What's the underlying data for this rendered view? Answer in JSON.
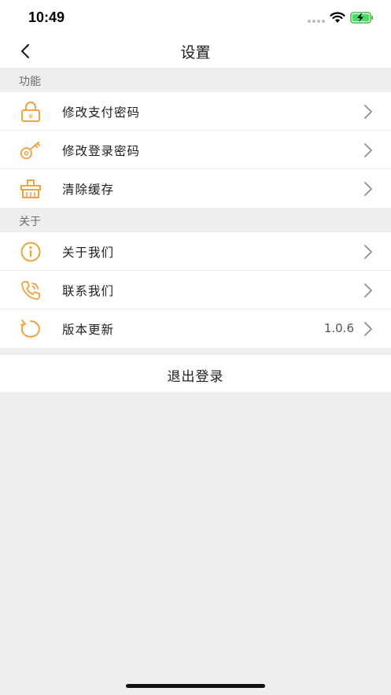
{
  "status_bar": {
    "time": "10:49"
  },
  "header": {
    "title": "设置"
  },
  "sections": [
    {
      "title": "功能",
      "items": [
        {
          "label": "修改支付密码",
          "icon": "payment-lock-icon"
        },
        {
          "label": "修改登录密码",
          "icon": "key-icon"
        },
        {
          "label": "清除缓存",
          "icon": "basket-icon"
        }
      ]
    },
    {
      "title": "关于",
      "items": [
        {
          "label": "关于我们",
          "icon": "info-icon"
        },
        {
          "label": "联系我们",
          "icon": "phone-icon"
        },
        {
          "label": "版本更新",
          "icon": "refresh-icon",
          "value": "1.0.6"
        }
      ]
    }
  ],
  "logout": {
    "label": "退出登录"
  },
  "colors": {
    "accent": "#f0a33c",
    "background": "#efefef",
    "chevron": "#8e8e8e"
  }
}
